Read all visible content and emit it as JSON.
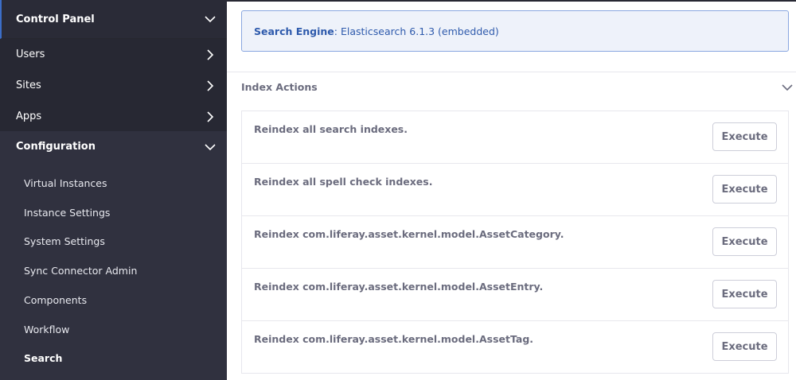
{
  "sidebar": {
    "title": "Control Panel",
    "sections": [
      {
        "label": "Users"
      },
      {
        "label": "Sites"
      },
      {
        "label": "Apps"
      }
    ],
    "configuration": {
      "label": "Configuration",
      "items": [
        {
          "label": "Virtual Instances"
        },
        {
          "label": "Instance Settings"
        },
        {
          "label": "System Settings"
        },
        {
          "label": "Sync Connector Admin"
        },
        {
          "label": "Components"
        },
        {
          "label": "Workflow"
        },
        {
          "label": "Search",
          "active": true
        }
      ]
    }
  },
  "main": {
    "alert": {
      "label": "Search Engine",
      "value": ": Elasticsearch 6.1.3 (embedded)"
    },
    "panel_title": "Index Actions",
    "rows": [
      {
        "text": "Reindex all search indexes.",
        "button": "Execute"
      },
      {
        "text": "Reindex all spell check indexes.",
        "button": "Execute"
      },
      {
        "text": "Reindex com.liferay.asset.kernel.model.AssetCategory.",
        "button": "Execute"
      },
      {
        "text": "Reindex com.liferay.asset.kernel.model.AssetEntry.",
        "button": "Execute"
      },
      {
        "text": "Reindex com.liferay.asset.kernel.model.AssetTag.",
        "button": "Execute"
      }
    ]
  },
  "colors": {
    "sidebar_bg": "#30313f",
    "sidebar_item_bg": "#272833",
    "accent": "#3c6ec8",
    "alert_text": "#2e5aac",
    "muted_text": "#6b6c7e"
  }
}
